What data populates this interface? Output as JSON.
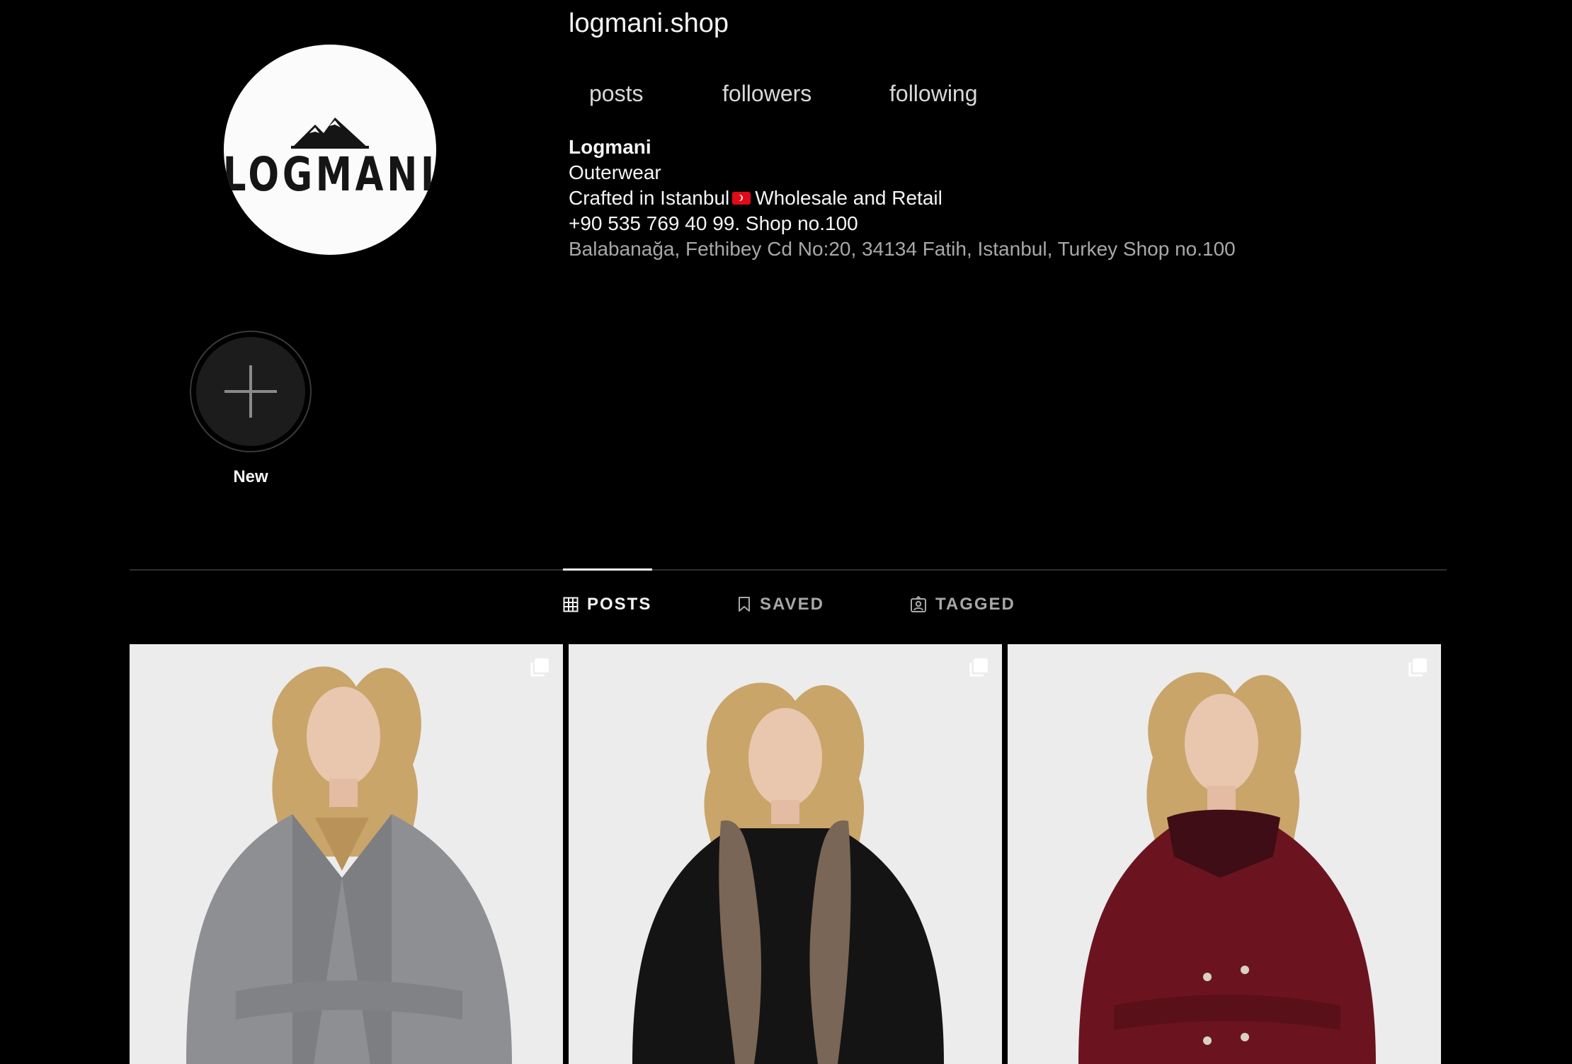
{
  "profile": {
    "username": "logmani.shop",
    "logo_text": "LOGMANI",
    "stats": [
      "posts",
      "followers",
      "following"
    ],
    "bio": {
      "name": "Logmani",
      "category": "Outerwear",
      "line1_a": "Crafted in Istanbul",
      "line1_b": "Wholesale and Retail",
      "phone": "+90 535 769 40 99. Shop no.100",
      "address": "Balabanağa, Fethibey Cd No:20, 34134 Fatih, Istanbul, Turkey Shop no.100"
    }
  },
  "highlights": [
    {
      "label": "New",
      "icon": "plus-icon"
    }
  ],
  "tabs": [
    {
      "label": "POSTS",
      "icon": "grid-icon",
      "active": true
    },
    {
      "label": "SAVED",
      "icon": "bookmark-icon",
      "active": false
    },
    {
      "label": "TAGGED",
      "icon": "tagged-icon",
      "active": false
    }
  ],
  "posts": [
    {
      "coat_color": "#8e8f92",
      "label": "grey wrap coat",
      "icon": "carousel-icon"
    },
    {
      "coat_color": "#141414",
      "label": "black coat with fur collar",
      "icon": "carousel-icon"
    },
    {
      "coat_color": "#6b1420",
      "label": "burgundy double-breasted coat",
      "icon": "carousel-icon"
    }
  ],
  "colors": {
    "background": "#000000",
    "text_primary": "#f5f5f5",
    "text_secondary": "#a8a8a8",
    "divider": "#2e2e2e"
  }
}
